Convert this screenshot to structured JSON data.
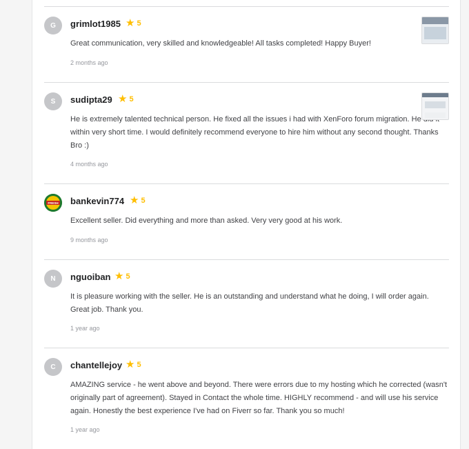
{
  "reviews": [
    {
      "avatar_letter": "G",
      "username": "grimlot1985",
      "score": "5",
      "text": "Great communication, very skilled and knowledgeable! All tasks completed! Happy Buyer!",
      "date": "2 months ago"
    },
    {
      "avatar_letter": "S",
      "username": "sudipta29",
      "score": "5",
      "text": "He is extremely talented technical person. He fixed all the issues i had with XenForo forum migration. He did it within very short time. I would definitely recommend everyone to hire him without any second thought. Thanks Bro :)",
      "date": "4 months ago"
    },
    {
      "avatar_letter": "FRESH",
      "username": "bankevin774",
      "score": "5",
      "text": "Excellent seller. Did everything and more than asked. Very very good at his work.",
      "date": "9 months ago"
    },
    {
      "avatar_letter": "N",
      "username": "nguoiban",
      "score": "5",
      "text": "It is pleasure working with the seller. He is an outstanding and understand what he doing, I will order again. Great job. Thank you.",
      "date": "1 year ago"
    },
    {
      "avatar_letter": "C",
      "username": "chantellejoy",
      "score": "5",
      "text": "AMAZING service - he went above and beyond. There were errors due to my hosting which he corrected (wasn't originally part of agreement). Stayed in Contact the whole time. HIGHLY recommend - and will use his service again. Honestly the best experience I've had on Fiverr so far. Thank you so much!",
      "date": "1 year ago"
    }
  ],
  "colors": {
    "star": "#ffbe00",
    "divider": "#dadbdd",
    "avatar_bg": "#c5c6c9"
  },
  "icons": {
    "rating": "star-icon"
  }
}
